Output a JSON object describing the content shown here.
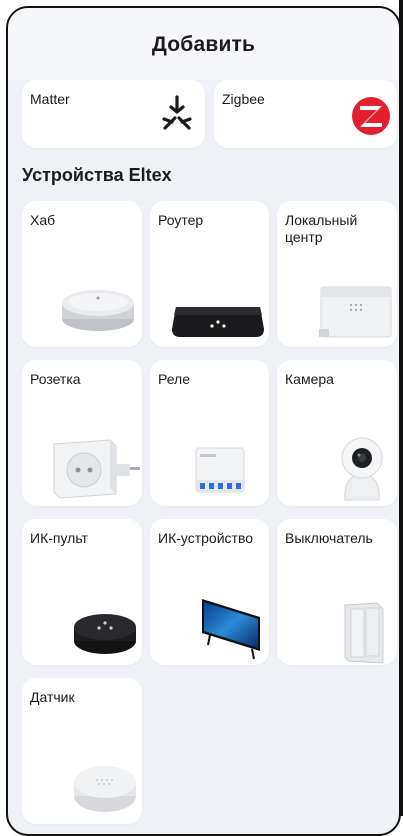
{
  "header": {
    "title": "Добавить"
  },
  "protocols": [
    {
      "label": "Matter",
      "icon": "matter-icon"
    },
    {
      "label": "Zigbee",
      "icon": "zigbee-icon"
    }
  ],
  "section_title": "Устройства Eltex",
  "devices": [
    {
      "label": "Хаб",
      "image": "hub-image"
    },
    {
      "label": "Роутер",
      "image": "router-image"
    },
    {
      "label": "Локальный центр",
      "image": "local-center-image"
    },
    {
      "label": "Розетка",
      "image": "socket-image"
    },
    {
      "label": "Реле",
      "image": "relay-image"
    },
    {
      "label": "Камера",
      "image": "camera-image"
    },
    {
      "label": "ИК-пульт",
      "image": "ir-remote-image"
    },
    {
      "label": "ИК-устройство",
      "image": "ir-device-image"
    },
    {
      "label": "Выключатель",
      "image": "switch-image"
    },
    {
      "label": "Датчик",
      "image": "sensor-image"
    }
  ],
  "colors": {
    "background": "#eef1f6",
    "card": "#ffffff",
    "zigbee": "#e5202e"
  }
}
